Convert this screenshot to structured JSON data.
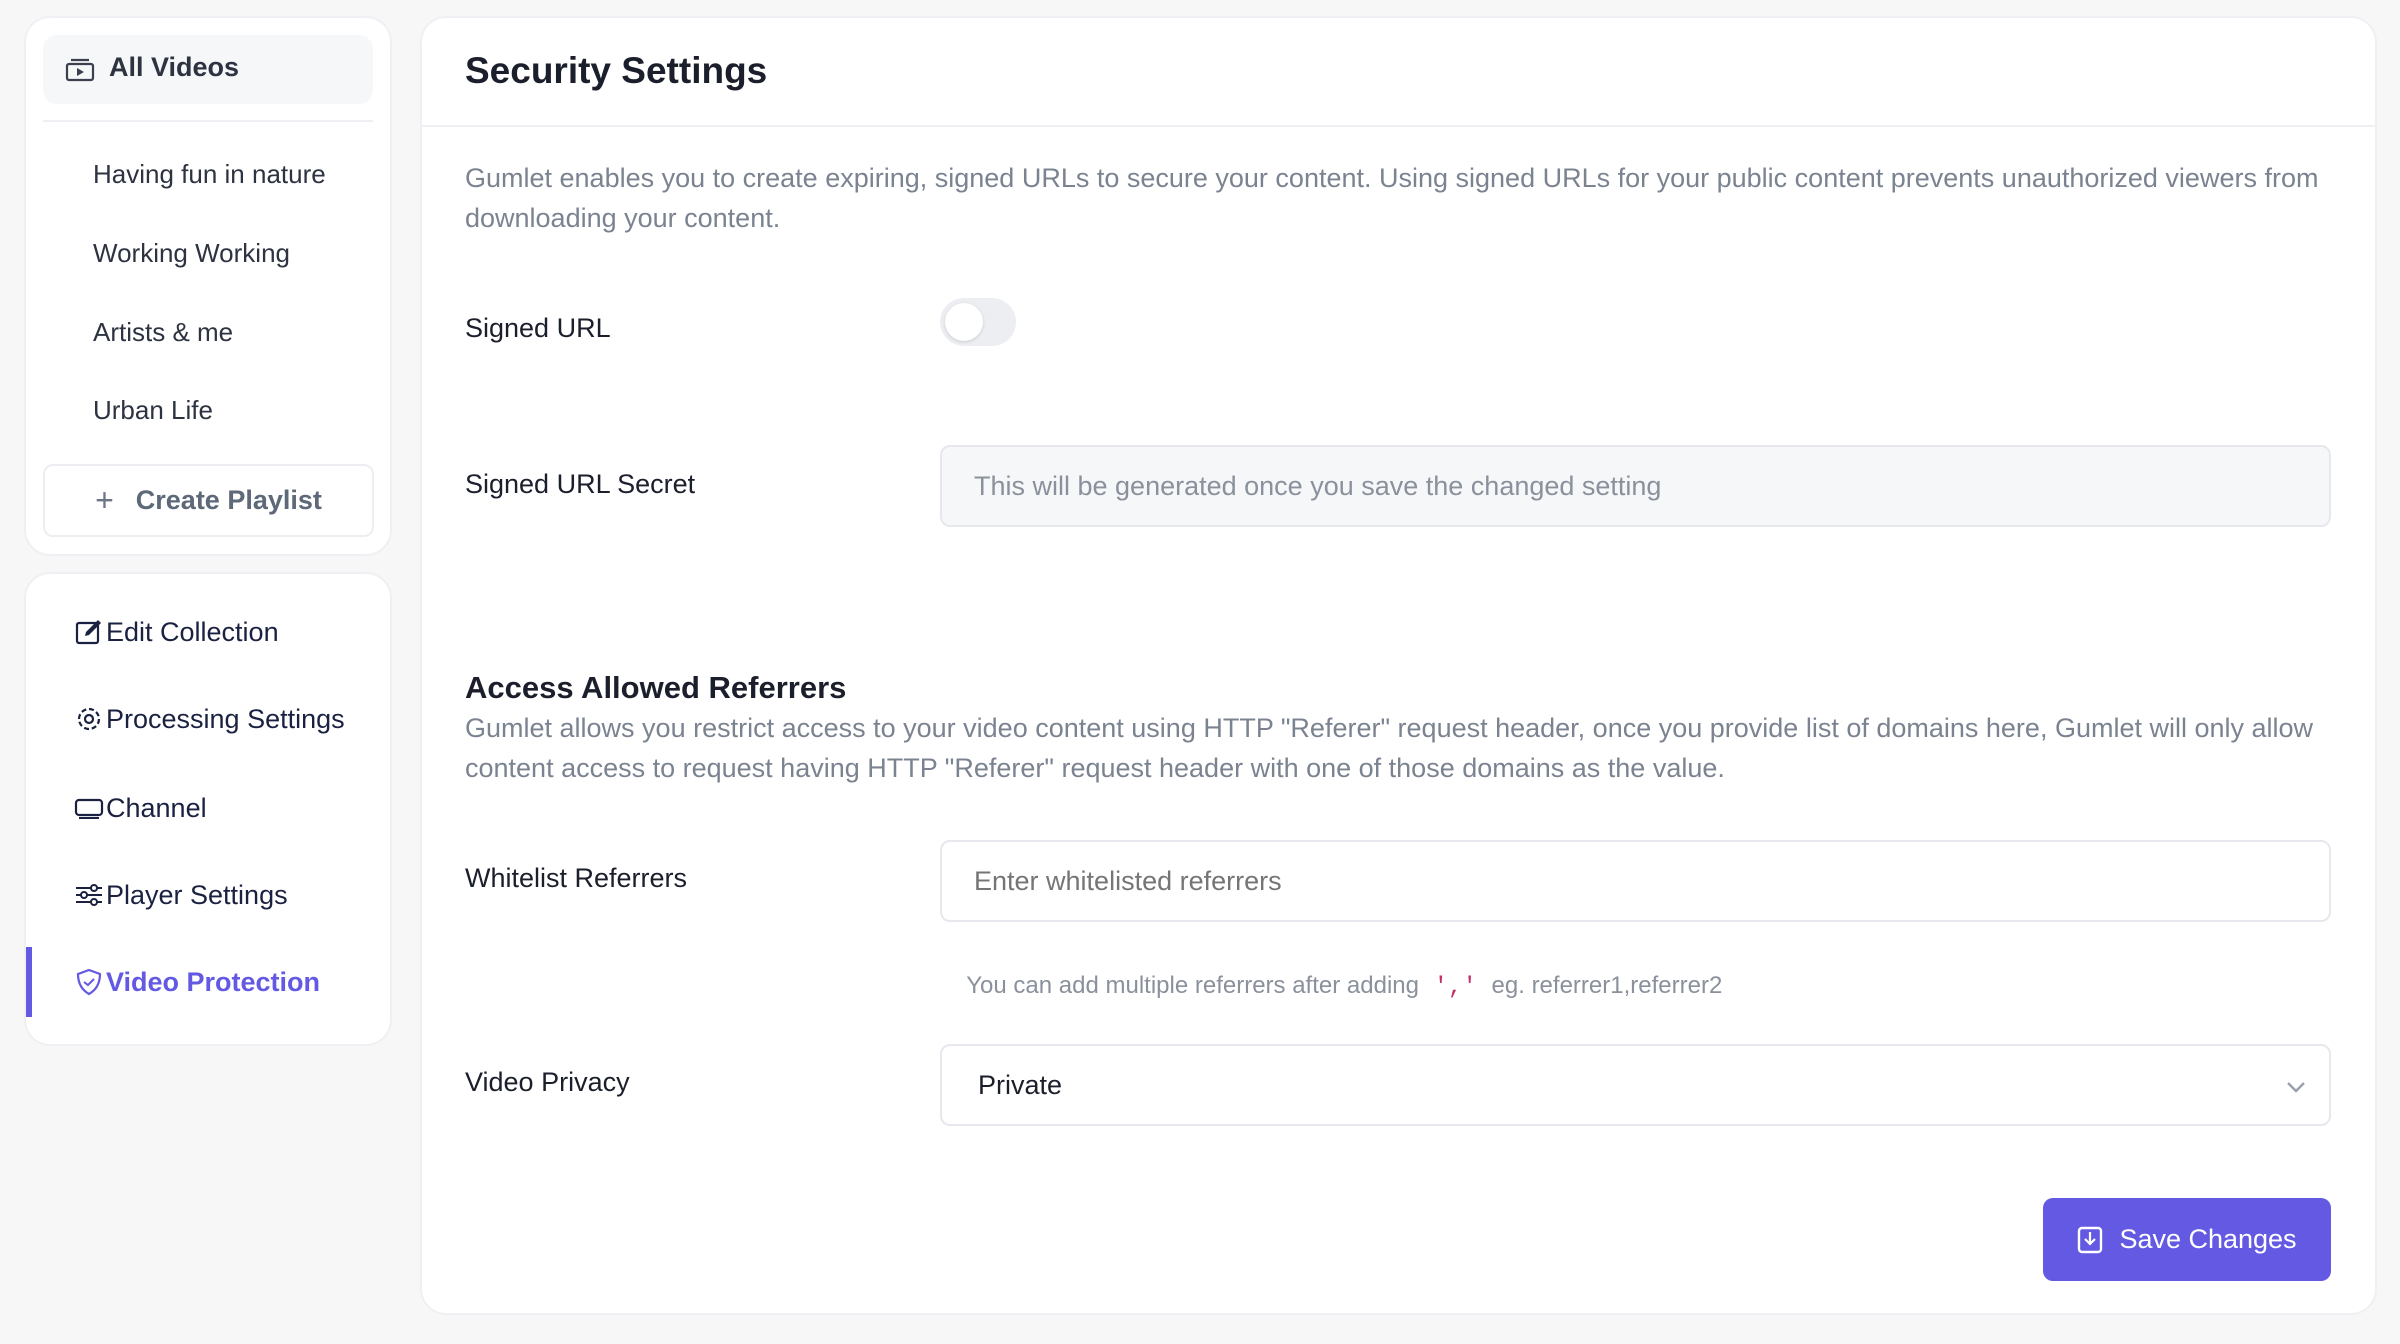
{
  "sidebar": {
    "all_videos": "All Videos",
    "playlists": [
      "Having fun in nature",
      "Working Working",
      "Artists & me",
      "Urban Life"
    ],
    "create_playlist": "Create Playlist",
    "menu": [
      {
        "label": "Edit Collection",
        "icon": "edit-icon"
      },
      {
        "label": "Processing Settings",
        "icon": "gear-icon"
      },
      {
        "label": "Channel",
        "icon": "monitor-icon"
      },
      {
        "label": "Player Settings",
        "icon": "sliders-icon"
      },
      {
        "label": "Video Protection",
        "icon": "shield-icon",
        "active": true
      }
    ]
  },
  "main": {
    "title": "Security Settings",
    "description": "Gumlet enables you to create expiring, signed URLs to secure your content. Using signed URLs for your public content prevents unauthorized viewers from downloading your content.",
    "signed_url_label": "Signed URL",
    "signed_url_enabled": false,
    "secret_label": "Signed URL Secret",
    "secret_placeholder": "This will be generated once you save the changed setting",
    "referrers_heading": "Access Allowed Referrers",
    "referrers_description": "Gumlet allows you restrict access to your video content using HTTP \"Referer\" request header, once you provide list of domains here, Gumlet will only allow content access to request having HTTP \"Referer\" request header with one of those domains as the value.",
    "whitelist_label": "Whitelist Referrers",
    "whitelist_placeholder": "Enter whitelisted referrers",
    "hint_prefix": "You can add multiple referrers after adding",
    "hint_code": "','",
    "hint_suffix": "eg. referrer1,referrer2",
    "privacy_label": "Video Privacy",
    "privacy_value": "Private",
    "save_label": "Save Changes"
  },
  "colors": {
    "accent": "#6359e3",
    "hint_code": "#c0306b"
  }
}
